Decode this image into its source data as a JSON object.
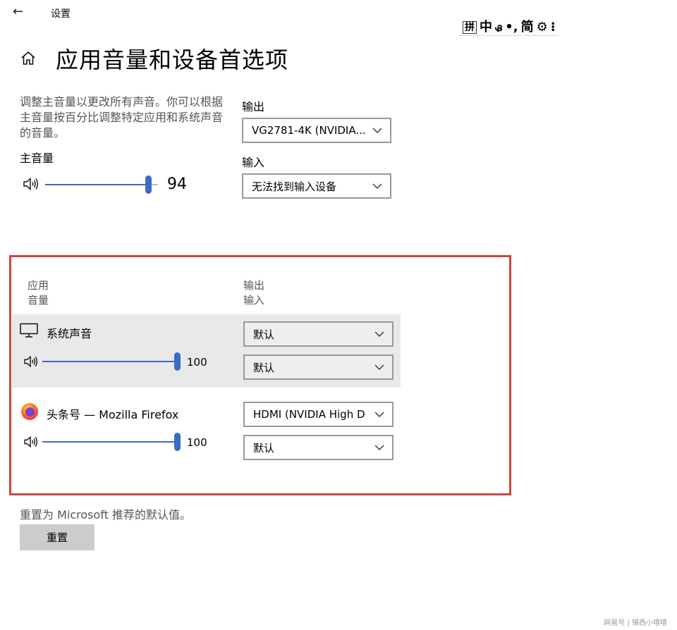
{
  "titlebar": {
    "back_glyph": "←",
    "title": "设置"
  },
  "ime": {
    "items": [
      "拼",
      "中",
      "ᏸ",
      "•,",
      "简",
      "⚙",
      "⁝"
    ]
  },
  "header": {
    "title": "应用音量和设备首选项"
  },
  "master": {
    "description": "调整主音量以更改所有声音。你可以根据主音量按百分比调整特定应用和系统声音的音量。",
    "label": "主音量",
    "value": 94,
    "value_text": "94"
  },
  "output": {
    "label": "输出",
    "selected": "VG2781-4K (NVIDIA..."
  },
  "input": {
    "label": "输入",
    "selected": "无法找到输入设备"
  },
  "apps_section": {
    "col_app_line1": "应用",
    "col_app_line2": "音量",
    "col_io_line1": "输出",
    "col_io_line2": "输入",
    "apps": [
      {
        "name": "系统声音",
        "icon": "monitor-icon",
        "volume": 100,
        "volume_text": "100",
        "output": "默认",
        "input": "默认"
      },
      {
        "name": "头条号 — Mozilla Firefox",
        "icon": "firefox-icon",
        "volume": 100,
        "volume_text": "100",
        "output": "HDMI (NVIDIA High D",
        "input": "默认"
      }
    ]
  },
  "reset": {
    "text": "重置为 Microsoft 推荐的默认值。",
    "button": "重置"
  },
  "watermark": "网易号 | 锡西小嘻嘻",
  "colors": {
    "accent": "#3a6bc6",
    "highlight_border": "#d0453e",
    "row_highlight": "#e9e9e9",
    "button_bg": "#cccccc"
  }
}
